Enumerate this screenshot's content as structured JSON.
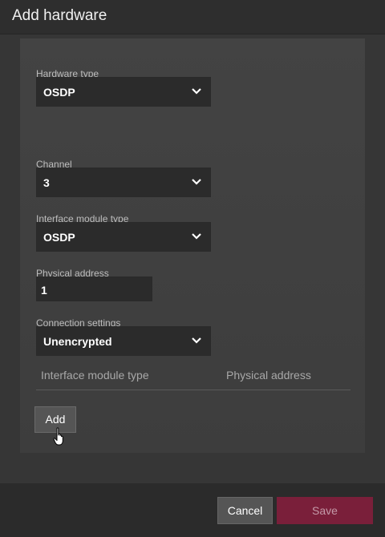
{
  "dialog": {
    "title": "Add hardware"
  },
  "form": {
    "hardware_type": {
      "label": "Hardware type",
      "value": "OSDP"
    },
    "channel": {
      "label": "Channel",
      "value": "3"
    },
    "interface_module_type": {
      "label": "Interface module type",
      "value": "OSDP"
    },
    "physical_address": {
      "label": "Physical address",
      "value": "1"
    },
    "connection_settings": {
      "label": "Connection settings",
      "value": "Unencrypted"
    }
  },
  "table": {
    "columns": [
      "Interface module type",
      "Physical address"
    ]
  },
  "buttons": {
    "add": "Add",
    "cancel": "Cancel",
    "save": "Save"
  },
  "icons": {
    "dropdown": "chevron-down-icon",
    "cursor": "hand-pointer-icon"
  },
  "colors": {
    "save_accent": "#7a1f3a"
  }
}
